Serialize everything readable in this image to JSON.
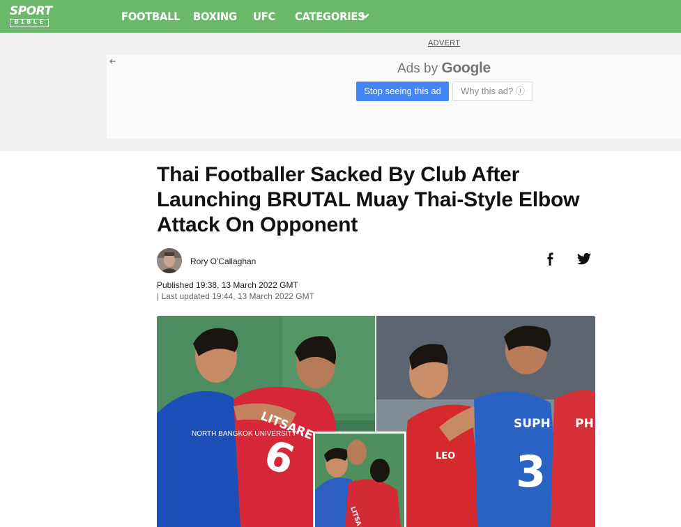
{
  "header": {
    "logo_top": "SPORT",
    "logo_bottom": "BIBLE",
    "nav": [
      {
        "label": "FOOTBALL"
      },
      {
        "label": "BOXING"
      },
      {
        "label": "UFC"
      },
      {
        "label": "CATEGORIES"
      }
    ]
  },
  "ad": {
    "advert_label": "ADVERT",
    "ads_by": "Ads by ",
    "google": "Google",
    "stop_button": "Stop seeing this ad",
    "why_button": "Why this ad? ⓘ"
  },
  "article": {
    "title": "Thai Footballer Sacked By Club After Launching BRUTAL Muay Thai-Style Elbow Attack On Opponent",
    "author": "Rory O'Callaghan",
    "published": "Published 19:38, 13 March 2022 GMT",
    "updated": "| Last updated 19:44, 13 March 2022 GMT",
    "image_text": {
      "shirt_left": "LITSARET",
      "number_left": "6",
      "sponsor_left": "NORTH BANGKOK UNIVERSITY",
      "shirt_right": "SUPH",
      "number_right": "3",
      "shirt_far": "PH",
      "sponsor_right": "LEO",
      "inset_shirt": "LITSA"
    }
  },
  "colors": {
    "nav_bg": "#6bb86a",
    "ad_button": "#4285f4"
  },
  "icons": [
    "chevron-down-icon",
    "back-arrow-icon",
    "facebook-icon",
    "twitter-icon",
    "info-icon"
  ]
}
